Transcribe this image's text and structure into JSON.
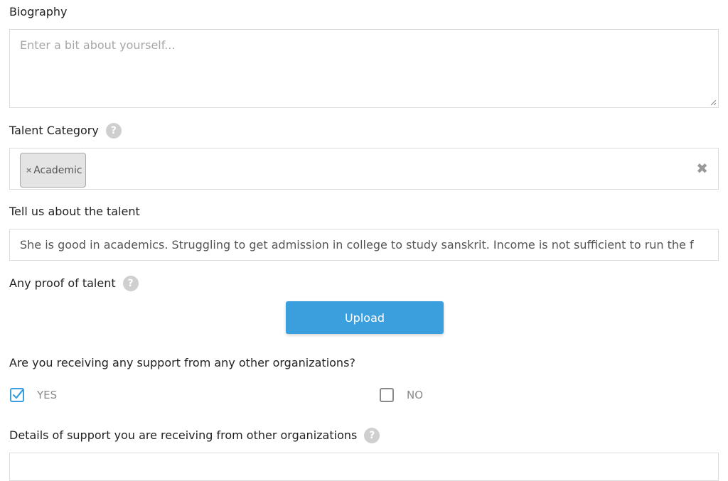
{
  "biography": {
    "label": "Biography",
    "placeholder": "Enter a bit about yourself..."
  },
  "talent_category": {
    "label": "Talent Category",
    "help": "?",
    "tags": [
      {
        "remove": "×",
        "label": "Academic"
      }
    ],
    "clear": "✖"
  },
  "talent_details": {
    "label": "Tell us about the talent",
    "value": "She is good in academics. Struggling to get admission in college to study sanskrit. Income is not sufficient to run the f"
  },
  "proof": {
    "label": "Any proof of talent",
    "help": "?",
    "button_label": "Upload"
  },
  "support": {
    "question": "Are you receiving any support from any other organizations?",
    "options": [
      {
        "label": "YES",
        "checked": true
      },
      {
        "label": "NO",
        "checked": false
      }
    ],
    "accent_color": "#3b9fdd"
  },
  "support_details": {
    "label": "Details of support you are receiving from other organizations",
    "help": "?"
  }
}
